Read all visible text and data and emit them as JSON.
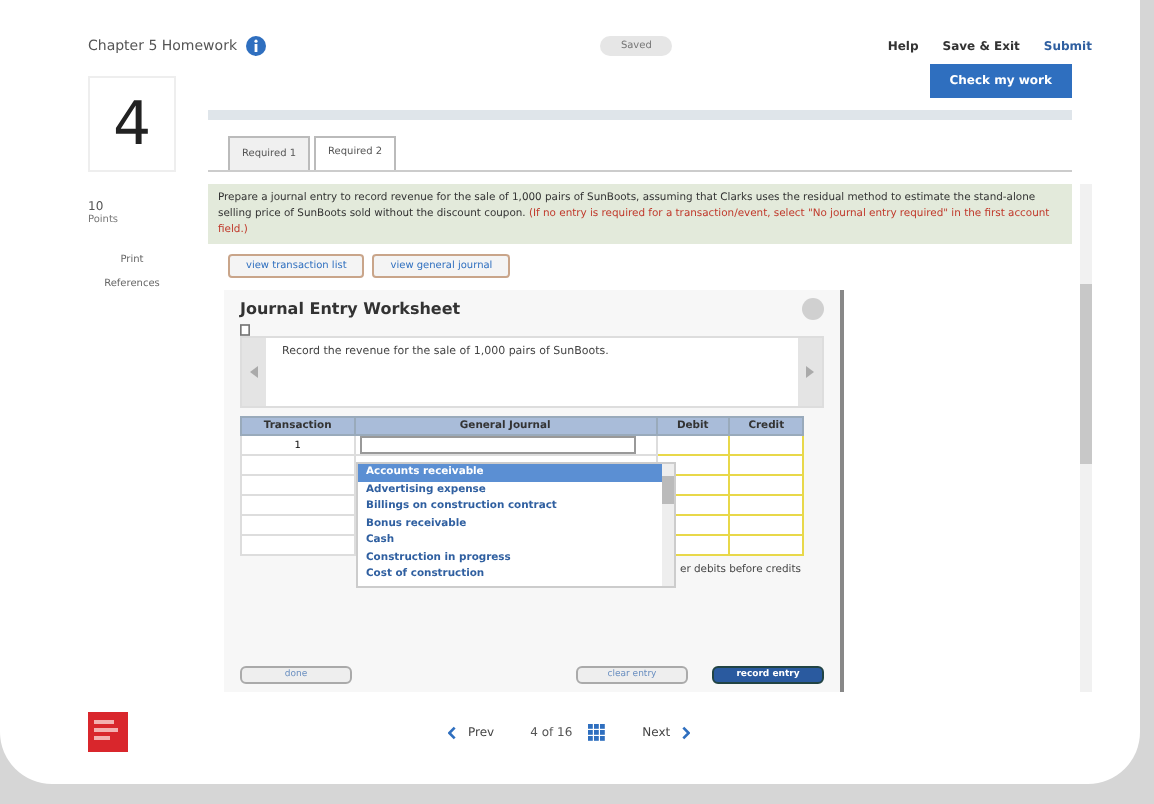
{
  "header": {
    "title": "Chapter 5 Homework",
    "status": "Saved",
    "links": [
      "Help",
      "Save & Exit",
      "Submit"
    ]
  },
  "question": {
    "number": "4",
    "points": "10",
    "points_label": "Points",
    "links": [
      "Print",
      "References"
    ]
  },
  "check_button": "Check my work",
  "tabs": [
    {
      "label": "Required 1",
      "selected": false
    },
    {
      "label": "Required 2",
      "selected": true
    }
  ],
  "instructions": {
    "text": "Prepare a journal entry to record revenue for the sale of 1,000 pairs of SunBoots, assuming that Clarks uses the residual method to estimate the stand-alone selling price of SunBoots sold without the discount coupon.",
    "note": "(If no entry is required for a transaction/event, select \"No journal entry required\" in the first account field.)"
  },
  "view_buttons": [
    "view transaction list",
    "view general journal"
  ],
  "worksheet": {
    "title": "Journal Entry Worksheet",
    "description": "Record the revenue for the sale of 1,000 pairs of SunBoots.",
    "columns": [
      "Transaction",
      "General Journal",
      "Debit",
      "Credit"
    ],
    "rows": [
      {
        "kind": "entry",
        "transaction": "1"
      },
      {
        "kind": "blank"
      },
      {
        "kind": "blank"
      },
      {
        "kind": "blank"
      },
      {
        "kind": "blank"
      },
      {
        "kind": "blank"
      }
    ],
    "dropdown": [
      {
        "label": "Accounts receivable",
        "selected": true
      },
      {
        "label": "Advertising expense",
        "selected": false
      },
      {
        "label": "Billings on construction contract",
        "selected": false
      },
      {
        "label": "Bonus receivable",
        "selected": false
      },
      {
        "label": "Cash",
        "selected": false
      },
      {
        "label": "Construction in progress",
        "selected": false
      },
      {
        "label": "Cost of construction",
        "selected": false
      }
    ],
    "note": "er debits before credits",
    "buttons": [
      {
        "label": "done",
        "kind": "plain"
      },
      {
        "label": "clear entry",
        "kind": "plain"
      },
      {
        "label": "record entry",
        "kind": "primary"
      }
    ]
  },
  "pager": {
    "prev": "Prev",
    "position": "4 of 16",
    "next": "Next"
  }
}
